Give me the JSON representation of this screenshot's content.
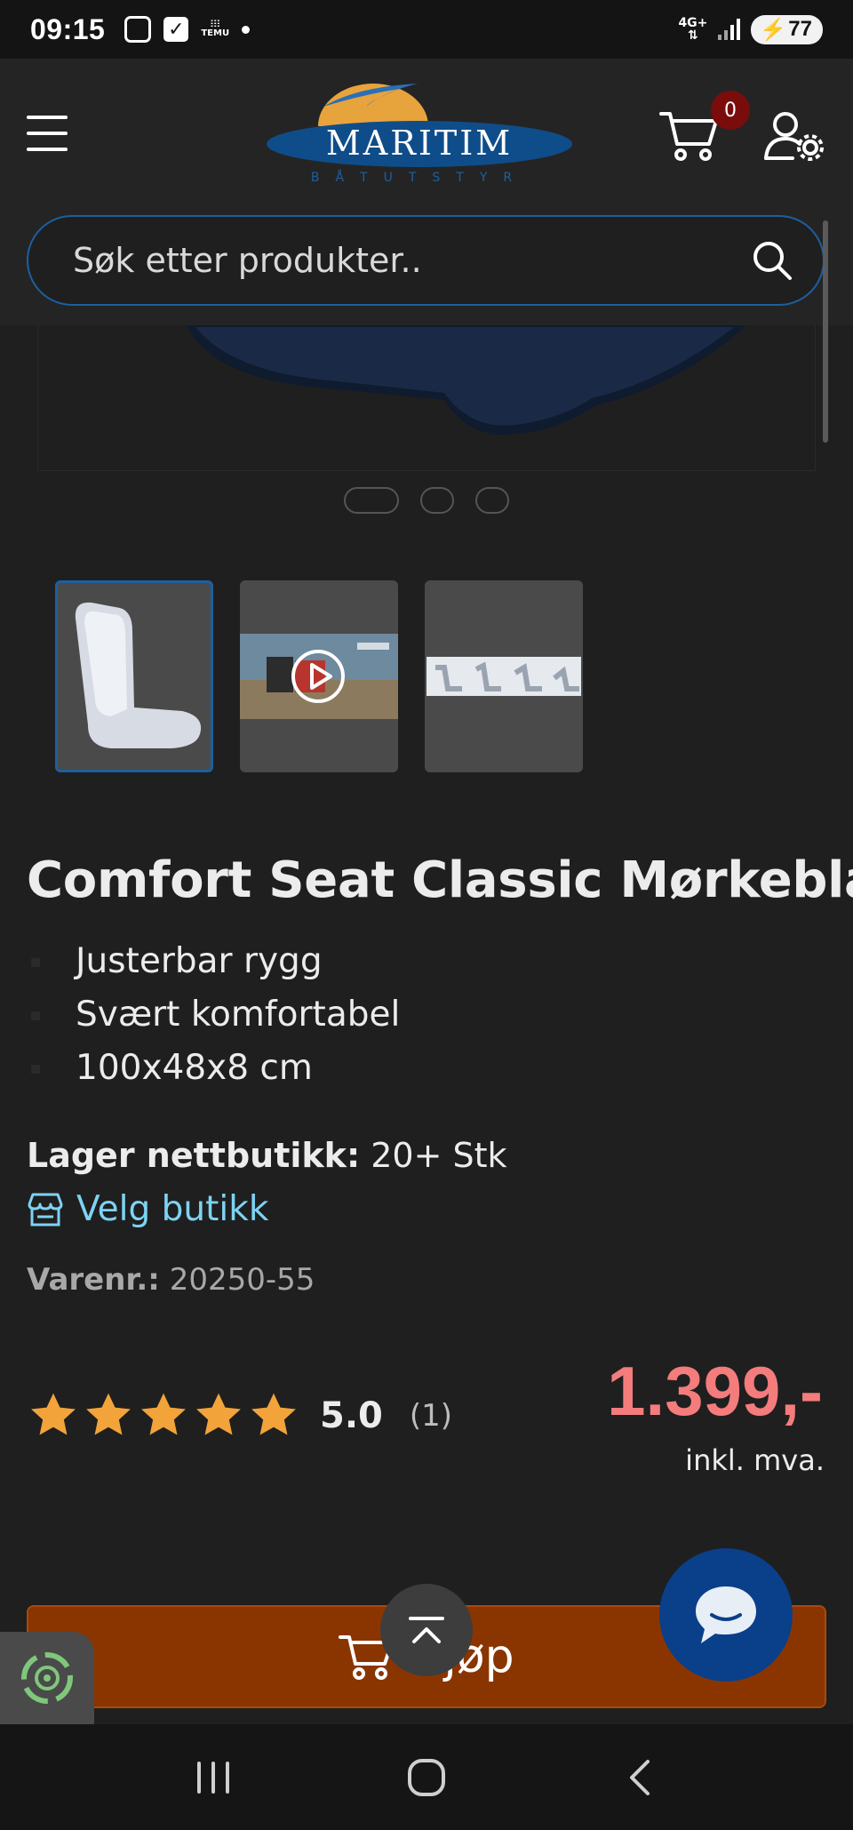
{
  "status_bar": {
    "time": "09:15",
    "temu_label": "TEMU",
    "network": "4G+",
    "battery": "77"
  },
  "header": {
    "logo_text": "MARITIM",
    "logo_subtext": "BÅTUTSTYR",
    "cart_count": "0"
  },
  "search": {
    "placeholder": "Søk etter produkter.."
  },
  "gallery": {
    "slide_count": 3,
    "active_slide": 1,
    "thumbnails": [
      "seat",
      "video",
      "strip"
    ]
  },
  "product": {
    "title": "Comfort Seat Classic Mørkeblå",
    "features": [
      "Justerbar rygg",
      "Svært komfortabel",
      "100x48x8 cm"
    ],
    "stock_label": "Lager nettbutikk:",
    "stock_value": "20+ Stk",
    "store_link": "Velg butikk",
    "sku_label": "Varenr.:",
    "sku_value": "20250-55",
    "rating": "5.0",
    "rating_count": "(1)",
    "stars": 5,
    "price": "1.399,-",
    "vat_note": "inkl. mva.",
    "buy_label": "Kjøp"
  },
  "colors": {
    "accent_blue": "#1d5fa0",
    "price_red": "#f47c7c",
    "star_orange": "#f2a43a",
    "buy_orange": "#8a3500",
    "link_cyan": "#7dd3f2"
  }
}
